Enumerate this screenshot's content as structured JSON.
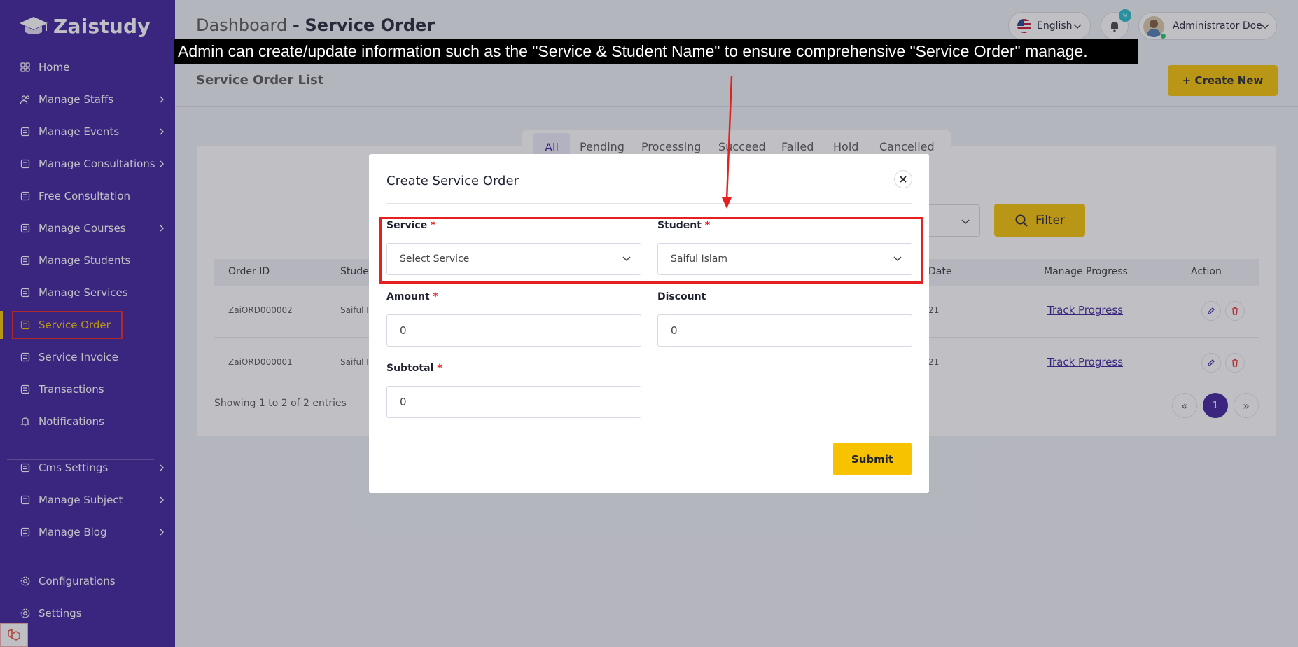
{
  "app": {
    "name": "Zaistudy"
  },
  "sidebar": {
    "items": [
      {
        "label": "Home",
        "icon": "home-icon",
        "has_submenu": false
      },
      {
        "label": "Manage Staffs",
        "icon": "users-icon",
        "has_submenu": true
      },
      {
        "label": "Manage Events",
        "icon": "calendar-icon",
        "has_submenu": true
      },
      {
        "label": "Manage Consultations",
        "icon": "consult-icon",
        "has_submenu": true
      },
      {
        "label": "Free Consultation",
        "icon": "chat-icon",
        "has_submenu": false
      },
      {
        "label": "Manage Courses",
        "icon": "course-icon",
        "has_submenu": true
      },
      {
        "label": "Manage Students",
        "icon": "students-icon",
        "has_submenu": false
      },
      {
        "label": "Manage Services",
        "icon": "services-icon",
        "has_submenu": false
      },
      {
        "label": "Service Order",
        "icon": "order-icon",
        "has_submenu": false,
        "active": true
      },
      {
        "label": "Service Invoice",
        "icon": "invoice-icon",
        "has_submenu": false
      },
      {
        "label": "Transactions",
        "icon": "transactions-icon",
        "has_submenu": false
      },
      {
        "label": "Notifications",
        "icon": "bell-icon",
        "has_submenu": false
      },
      {
        "label": "Cms Settings",
        "icon": "cms-icon",
        "has_submenu": true
      },
      {
        "label": "Manage Subject",
        "icon": "book-icon",
        "has_submenu": true
      },
      {
        "label": "Manage Blog",
        "icon": "blog-icon",
        "has_submenu": true
      },
      {
        "label": "Configurations",
        "icon": "config-icon",
        "has_submenu": false
      },
      {
        "label": "Settings",
        "icon": "settings-icon",
        "has_submenu": false
      }
    ]
  },
  "header": {
    "title_prefix": "Dashboard",
    "title_sep": "-",
    "title_main": "Service Order",
    "language": "English",
    "notification_count": "9",
    "user_name": "Administrator Doe"
  },
  "page": {
    "list_title": "Service Order List",
    "create_button": "+ Create New",
    "tabs": [
      "All",
      "Pending",
      "Processing",
      "Succeed",
      "Failed",
      "Hold",
      "Cancelled"
    ],
    "filter_button": "Filter",
    "table": {
      "headers": [
        "Order ID",
        "Studen",
        "Date",
        "Manage Progress",
        "Action"
      ],
      "rows": [
        {
          "order_id": "ZaiORD000002",
          "student": "Saiful Is",
          "date": "21",
          "progress": "Track Progress"
        },
        {
          "order_id": "ZaiORD000001",
          "student": "Saiful Is",
          "date": "21",
          "progress": "Track Progress"
        }
      ]
    },
    "showing": "Showing 1 to 2 of 2 entries",
    "pagination": {
      "prev": "«",
      "current": "1",
      "next": "»"
    }
  },
  "modal": {
    "title": "Create Service Order",
    "service_label": "Service",
    "service_placeholder": "Select Service",
    "student_label": "Student",
    "student_value": "Saiful Islam",
    "amount_label": "Amount",
    "amount_value": "0",
    "discount_label": "Discount",
    "discount_value": "0",
    "subtotal_label": "Subtotal",
    "subtotal_value": "0",
    "required_mark": "*",
    "submit": "Submit"
  },
  "annotation": {
    "text": "Admin can create/update information such as the \"Service & Student Name\" to ensure comprehensive \"Service Order\" manage."
  },
  "colors": {
    "sidebar_bg": "#3a1d9a",
    "accent": "#f7c200",
    "highlight": "#e52020",
    "link": "#3a1d9a"
  }
}
